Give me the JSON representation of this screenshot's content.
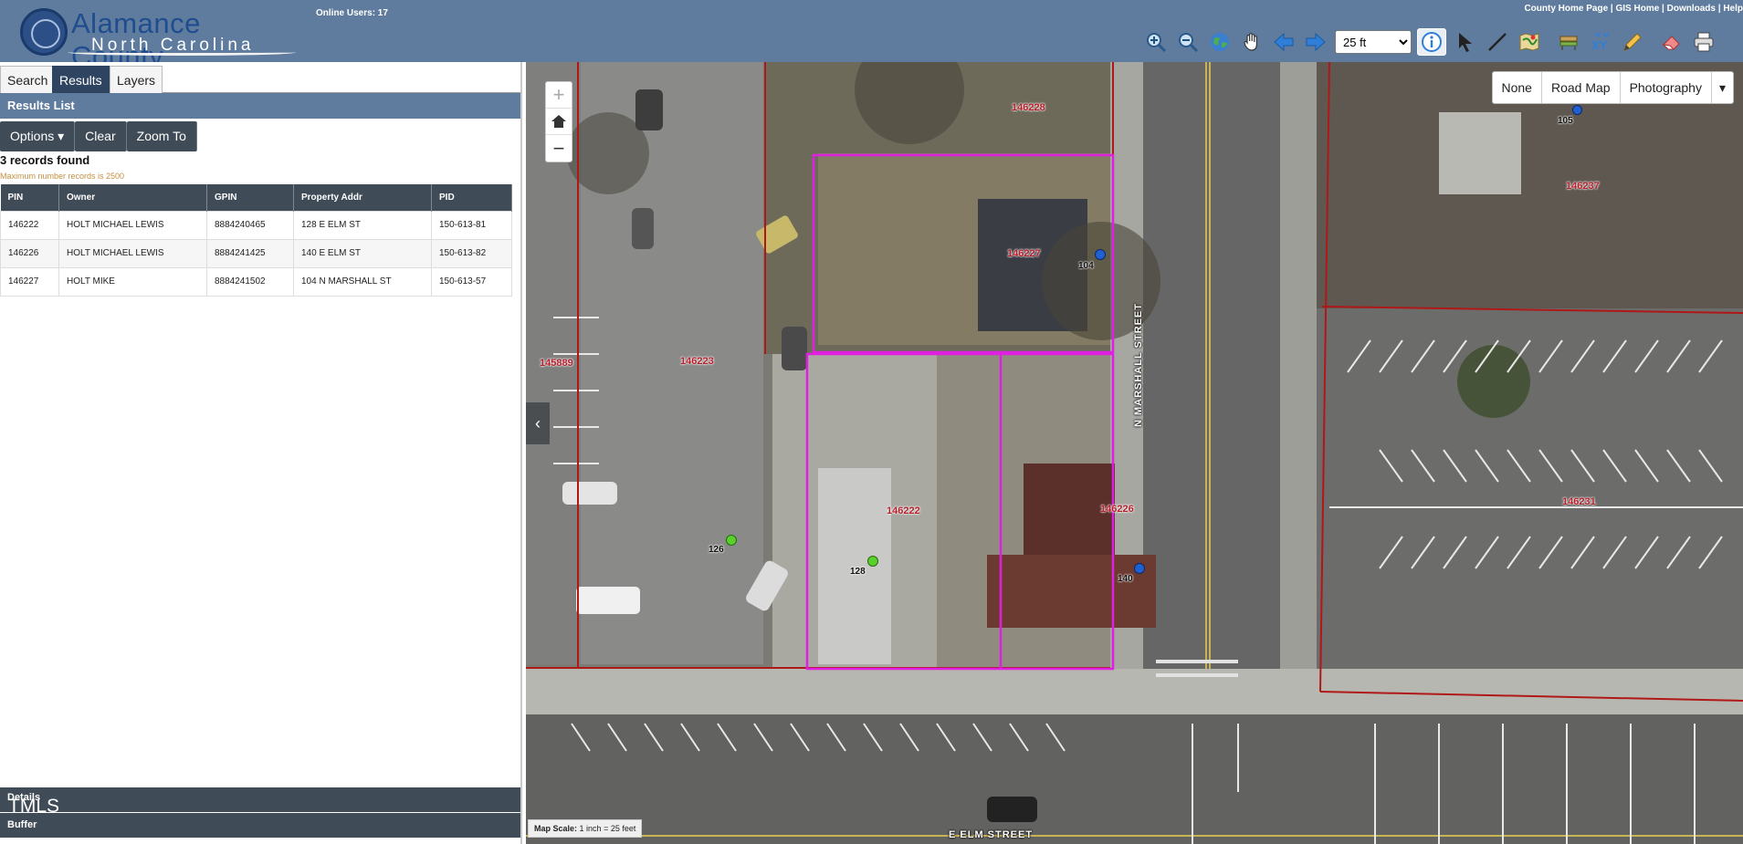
{
  "header": {
    "logo_line1": "Alamance County",
    "logo_line2": "North Carolina",
    "online_users": "Online Users: 17",
    "links": "County Home Page | GIS Home | Downloads | Help"
  },
  "toolbar": {
    "scale_value": "25 ft",
    "icons": [
      "zoom-in-icon",
      "zoom-out-icon",
      "globe-icon",
      "pan-hand-icon",
      "back-arrow-icon",
      "forward-arrow-icon",
      "info-icon",
      "select-arrow-icon",
      "measure-line-icon",
      "map-icon",
      "bench-icon",
      "xy-icon",
      "pencil-icon",
      "eraser-icon",
      "print-icon"
    ]
  },
  "left_panel": {
    "tabs": [
      "Search",
      "Results",
      "Layers"
    ],
    "results_header": "Results List",
    "buttons": {
      "options": "Options ▾",
      "clear": "Clear",
      "zoom_to": "Zoom To"
    },
    "records_found": "3 records found",
    "max_note": "Maximum number records is 2500",
    "table": {
      "columns": [
        "PIN",
        "Owner",
        "GPIN",
        "Property Addr",
        "PID"
      ],
      "rows": [
        [
          "146222",
          "HOLT MICHAEL LEWIS",
          "8884240465",
          "128 E ELM ST",
          "150-613-81"
        ],
        [
          "146226",
          "HOLT MICHAEL LEWIS",
          "8884241425",
          "140 E ELM ST",
          "150-613-82"
        ],
        [
          "146227",
          "HOLT MIKE",
          "8884241502",
          "104 N MARSHALL ST",
          "150-613-57"
        ]
      ]
    },
    "details_label": "Details",
    "watermark": "TMLS",
    "buffer_label": "Buffer"
  },
  "map": {
    "basemaps": [
      "None",
      "Road Map",
      "Photography"
    ],
    "scale_label": "Map Scale:",
    "scale_value": "1 inch = 25 feet",
    "parcel_labels": [
      "146228",
      "146227",
      "146223",
      "145889",
      "146222",
      "146226",
      "146237",
      "146231"
    ],
    "address_labels": [
      "105",
      "104",
      "126",
      "128",
      "140"
    ],
    "streets": [
      "N MARSHALL STREET",
      "E ELM STREET"
    ],
    "colors": {
      "selected_parcel": "#e020e0",
      "parcel_line": "#b01818",
      "address_blue": "#2060d0",
      "address_green": "#5ad02a"
    }
  }
}
